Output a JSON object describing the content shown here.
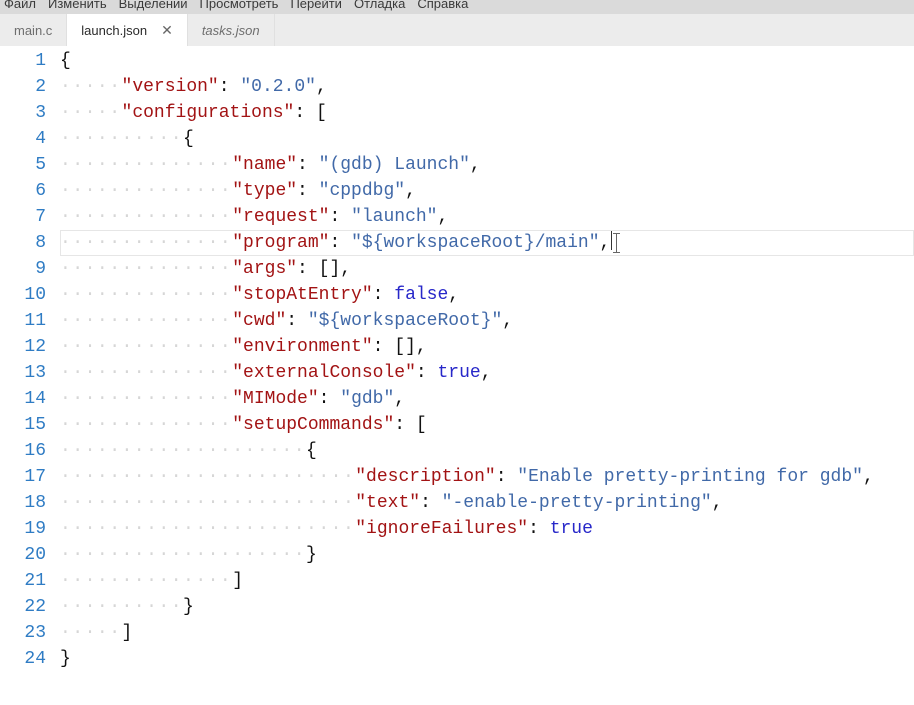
{
  "menu": {
    "items": [
      "Файл",
      "Изменить",
      "Выделении",
      "Просмотреть",
      "Перейти",
      "Отладка",
      "Справка"
    ]
  },
  "tabs": [
    {
      "label": "main.c",
      "active": false,
      "preview": false,
      "closeable": false
    },
    {
      "label": "launch.json",
      "active": true,
      "preview": false,
      "closeable": true
    },
    {
      "label": "tasks.json",
      "active": false,
      "preview": true,
      "closeable": false
    }
  ],
  "close_glyph": "✕",
  "editor": {
    "current_line": 8,
    "line_count": 24,
    "lines": [
      {
        "indent": 0,
        "tokens": [
          {
            "t": "punct",
            "v": "{"
          }
        ]
      },
      {
        "indent": 5,
        "tokens": [
          {
            "t": "key",
            "v": "\"version\""
          },
          {
            "t": "punct",
            "v": ": "
          },
          {
            "t": "str",
            "v": "\"0.2.0\""
          },
          {
            "t": "punct",
            "v": ","
          }
        ]
      },
      {
        "indent": 5,
        "tokens": [
          {
            "t": "key",
            "v": "\"configurations\""
          },
          {
            "t": "punct",
            "v": ": "
          },
          {
            "t": "punct",
            "v": "["
          }
        ]
      },
      {
        "indent": 10,
        "tokens": [
          {
            "t": "punct",
            "v": "{"
          }
        ]
      },
      {
        "indent": 14,
        "tokens": [
          {
            "t": "key",
            "v": "\"name\""
          },
          {
            "t": "punct",
            "v": ": "
          },
          {
            "t": "str",
            "v": "\"(gdb) Launch\""
          },
          {
            "t": "punct",
            "v": ","
          }
        ]
      },
      {
        "indent": 14,
        "tokens": [
          {
            "t": "key",
            "v": "\"type\""
          },
          {
            "t": "punct",
            "v": ": "
          },
          {
            "t": "str",
            "v": "\"cppdbg\""
          },
          {
            "t": "punct",
            "v": ","
          }
        ]
      },
      {
        "indent": 14,
        "tokens": [
          {
            "t": "key",
            "v": "\"request\""
          },
          {
            "t": "punct",
            "v": ": "
          },
          {
            "t": "str",
            "v": "\"launch\""
          },
          {
            "t": "punct",
            "v": ","
          }
        ]
      },
      {
        "indent": 14,
        "tokens": [
          {
            "t": "key",
            "v": "\"program\""
          },
          {
            "t": "punct",
            "v": ": "
          },
          {
            "t": "str",
            "v": "\"${workspaceRoot}/main\""
          },
          {
            "t": "punct",
            "v": ","
          }
        ]
      },
      {
        "indent": 14,
        "tokens": [
          {
            "t": "key",
            "v": "\"args\""
          },
          {
            "t": "punct",
            "v": ": "
          },
          {
            "t": "punct",
            "v": "[]"
          },
          {
            "t": "punct",
            "v": ","
          }
        ]
      },
      {
        "indent": 14,
        "tokens": [
          {
            "t": "key",
            "v": "\"stopAtEntry\""
          },
          {
            "t": "punct",
            "v": ": "
          },
          {
            "t": "kw",
            "v": "false"
          },
          {
            "t": "punct",
            "v": ","
          }
        ]
      },
      {
        "indent": 14,
        "tokens": [
          {
            "t": "key",
            "v": "\"cwd\""
          },
          {
            "t": "punct",
            "v": ": "
          },
          {
            "t": "str",
            "v": "\"${workspaceRoot}\""
          },
          {
            "t": "punct",
            "v": ","
          }
        ]
      },
      {
        "indent": 14,
        "tokens": [
          {
            "t": "key",
            "v": "\"environment\""
          },
          {
            "t": "punct",
            "v": ": "
          },
          {
            "t": "punct",
            "v": "[]"
          },
          {
            "t": "punct",
            "v": ","
          }
        ]
      },
      {
        "indent": 14,
        "tokens": [
          {
            "t": "key",
            "v": "\"externalConsole\""
          },
          {
            "t": "punct",
            "v": ": "
          },
          {
            "t": "kw",
            "v": "true"
          },
          {
            "t": "punct",
            "v": ","
          }
        ]
      },
      {
        "indent": 14,
        "tokens": [
          {
            "t": "key",
            "v": "\"MIMode\""
          },
          {
            "t": "punct",
            "v": ": "
          },
          {
            "t": "str",
            "v": "\"gdb\""
          },
          {
            "t": "punct",
            "v": ","
          }
        ]
      },
      {
        "indent": 14,
        "tokens": [
          {
            "t": "key",
            "v": "\"setupCommands\""
          },
          {
            "t": "punct",
            "v": ": "
          },
          {
            "t": "punct",
            "v": "["
          }
        ]
      },
      {
        "indent": 20,
        "tokens": [
          {
            "t": "punct",
            "v": "{"
          }
        ]
      },
      {
        "indent": 24,
        "tokens": [
          {
            "t": "key",
            "v": "\"description\""
          },
          {
            "t": "punct",
            "v": ": "
          },
          {
            "t": "str",
            "v": "\"Enable pretty-printing for gdb\""
          },
          {
            "t": "punct",
            "v": ","
          }
        ]
      },
      {
        "indent": 24,
        "tokens": [
          {
            "t": "key",
            "v": "\"text\""
          },
          {
            "t": "punct",
            "v": ": "
          },
          {
            "t": "str",
            "v": "\"-enable-pretty-printing\""
          },
          {
            "t": "punct",
            "v": ","
          }
        ]
      },
      {
        "indent": 24,
        "tokens": [
          {
            "t": "key",
            "v": "\"ignoreFailures\""
          },
          {
            "t": "punct",
            "v": ": "
          },
          {
            "t": "kw",
            "v": "true"
          }
        ]
      },
      {
        "indent": 20,
        "tokens": [
          {
            "t": "punct",
            "v": "}"
          }
        ]
      },
      {
        "indent": 14,
        "tokens": [
          {
            "t": "punct",
            "v": "]"
          }
        ]
      },
      {
        "indent": 10,
        "tokens": [
          {
            "t": "punct",
            "v": "}"
          }
        ]
      },
      {
        "indent": 5,
        "tokens": [
          {
            "t": "punct",
            "v": "]"
          }
        ]
      },
      {
        "indent": 0,
        "tokens": [
          {
            "t": "punct",
            "v": "}"
          }
        ]
      }
    ]
  }
}
